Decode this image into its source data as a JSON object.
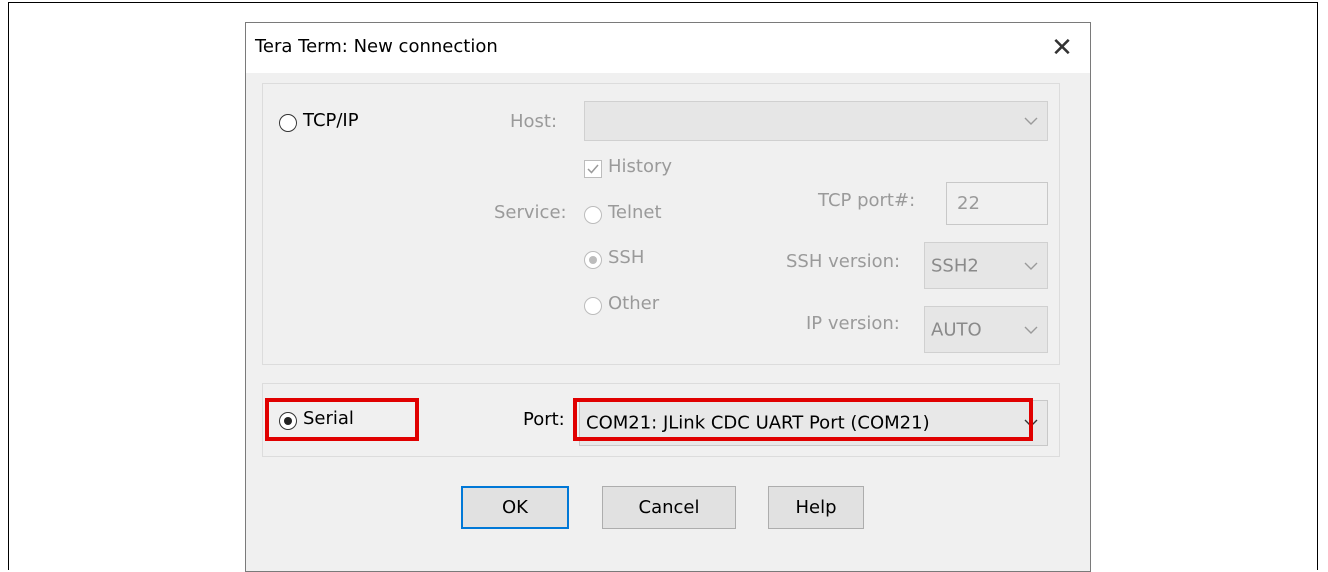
{
  "window": {
    "title": "Tera Term: New connection",
    "close_symbol": "✕"
  },
  "tcpip": {
    "radio_label": "TCP/IP",
    "host_label": "Host:",
    "host_value": "",
    "history_label": "History",
    "history_checked": true,
    "service_label": "Service:",
    "service_options": [
      "Telnet",
      "SSH",
      "Other"
    ],
    "service_selected": "SSH",
    "tcp_port_label": "TCP port#:",
    "tcp_port_value": "22",
    "ssh_version_label": "SSH version:",
    "ssh_version_value": "SSH2",
    "ip_version_label": "IP version:",
    "ip_version_value": "AUTO"
  },
  "serial": {
    "radio_label": "Serial",
    "selected": true,
    "port_label": "Port:",
    "port_value": "COM21: JLink CDC UART Port (COM21)"
  },
  "buttons": {
    "ok": "OK",
    "cancel": "Cancel",
    "help": "Help"
  },
  "icons": {
    "close": "close-icon",
    "dropdown": "chevron-down-icon"
  },
  "colors": {
    "highlight": "#e00000",
    "default_button_border": "#0078d7"
  }
}
